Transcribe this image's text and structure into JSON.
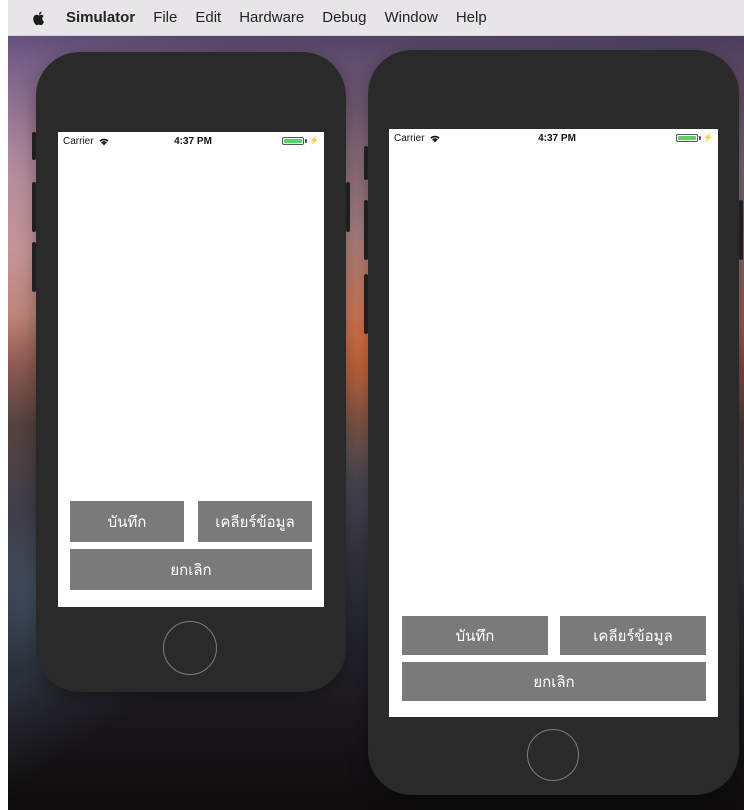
{
  "menu_bar": {
    "apple_icon": "apple-icon",
    "app_name": "Simulator",
    "items": [
      "File",
      "Edit",
      "Hardware",
      "Debug",
      "Window",
      "Help"
    ]
  },
  "simulators": [
    {
      "status_bar": {
        "carrier": "Carrier",
        "wifi_icon": "wifi-icon",
        "time": "4:37 PM",
        "battery_level": 1,
        "battery_icon": "battery-icon",
        "charging_icon": "bolt-icon"
      },
      "buttons": {
        "save": "บันทึก",
        "clear": "เคลียร์ข้อมูล",
        "cancel": "ยกเลิก"
      }
    },
    {
      "status_bar": {
        "carrier": "Carrier",
        "wifi_icon": "wifi-icon",
        "time": "4:37 PM",
        "battery_level": 1,
        "battery_icon": "battery-icon",
        "charging_icon": "bolt-icon"
      },
      "buttons": {
        "save": "บันทึก",
        "clear": "เคลียร์ข้อมูล",
        "cancel": "ยกเลิก"
      }
    }
  ],
  "colors": {
    "button_bg": "#7a7a7a",
    "button_text": "#ffffff",
    "phone_body": "#2a2a2a",
    "menu_bar_bg": "#e7e5e8",
    "battery_fill": "#56d364"
  }
}
